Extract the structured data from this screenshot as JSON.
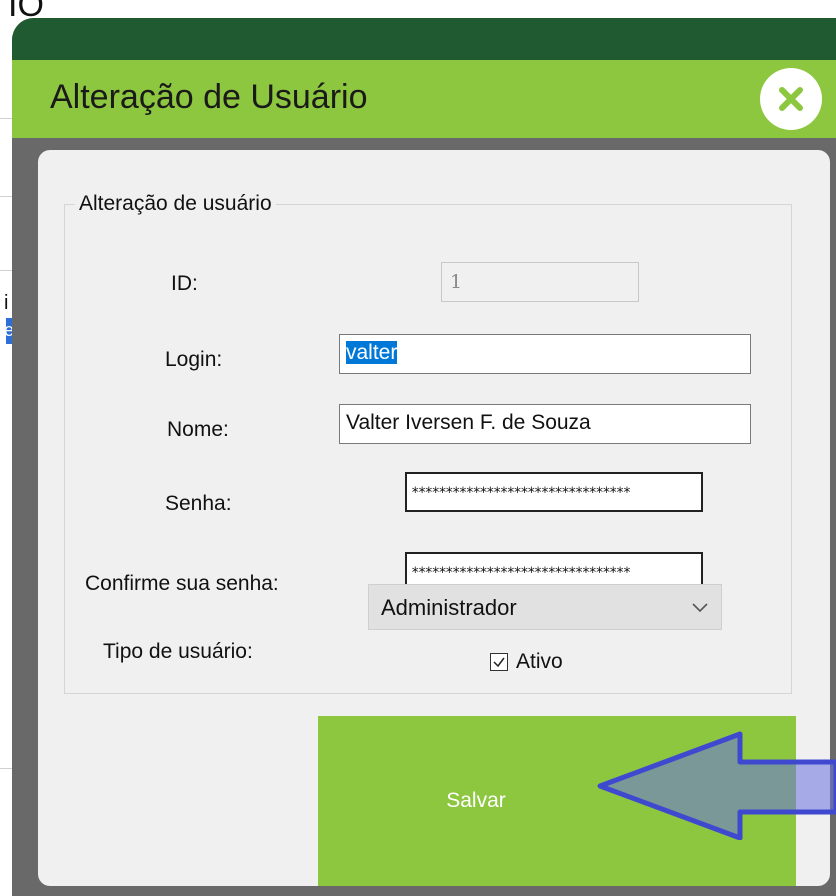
{
  "background": {
    "title_fragment": "IO",
    "side_chars": [
      "i",
      "e"
    ]
  },
  "dialog": {
    "title": "Alteração de Usuário",
    "close_icon": "close-icon",
    "group_title": "Alteração de usuário",
    "fields": {
      "id": {
        "label": "ID:",
        "value": "1"
      },
      "login": {
        "label": "Login:",
        "value": "valter"
      },
      "nome": {
        "label": "Nome:",
        "value": "Valter Iversen F. de Souza"
      },
      "senha": {
        "label": "Senha:",
        "value": "********************************"
      },
      "confirm": {
        "label": "Confirme sua senha:",
        "value": "********************************"
      },
      "tipo": {
        "label": "Tipo de usuário:",
        "value": "Administrador"
      },
      "ativo": {
        "label": "Ativo",
        "checked": true
      }
    },
    "save_label": "Salvar"
  },
  "colors": {
    "accent_green": "#8dc63f",
    "dark_green": "#1f5a31",
    "arrow_blue": "#4b55d6"
  },
  "annotation": {
    "icon": "left-arrow-icon"
  }
}
